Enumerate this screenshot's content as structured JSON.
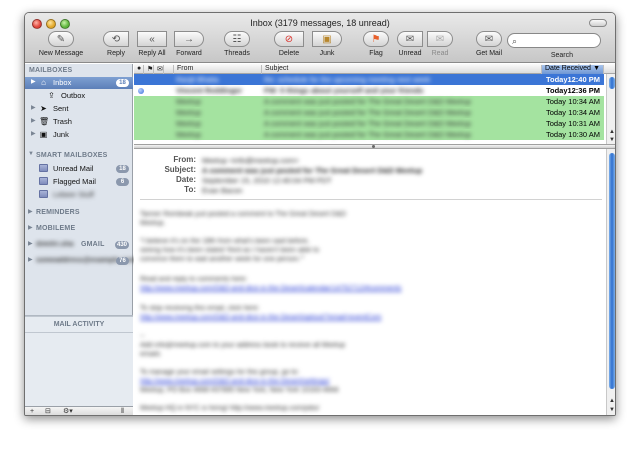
{
  "window": {
    "title": "Inbox (3179 messages, 18 unread)"
  },
  "toolbar": {
    "new_message": "New Message",
    "reply": "Reply",
    "reply_all": "Reply All",
    "forward": "Forward",
    "threads": "Threads",
    "delete": "Delete",
    "junk": "Junk",
    "flag": "Flag",
    "unread": "Unread",
    "read": "Read",
    "get_mail": "Get Mail",
    "search": "Search"
  },
  "sidebar": {
    "mailboxes_header": "MAILBOXES",
    "inbox": {
      "label": "Inbox",
      "badge": "18"
    },
    "outbox": "Outbox",
    "sent": "Sent",
    "trash": "Trash",
    "junk": "Junk",
    "smart_header": "SMART MAILBOXES",
    "unread_mail": {
      "label": "Unread Mail",
      "badge": "18"
    },
    "flagged_mail": {
      "label": "Flagged Mail",
      "badge": "6"
    },
    "smart_blurred": "Lebeer Stuff",
    "reminders_header": "REMINDERS",
    "mobileme_header": "MOBILEME",
    "gmail": {
      "prefix": "dimitri.sha",
      "label": "GMAIL",
      "badge": "430"
    },
    "account2": {
      "label": "someaddress@example.com",
      "badge": "76"
    },
    "mail_activity": "MAIL ACTIVITY"
  },
  "list": {
    "headers": {
      "from": "From",
      "subject": "Subject",
      "date": "Date Received"
    },
    "rows": [
      {
        "from": "Ranjit Bhatia",
        "subject": "Re: schedule for the upcoming meeting next week",
        "date": "Today",
        "time": "12:40 PM"
      },
      {
        "from": "Vincent Reddinger",
        "subject": "FW: 5 things about yourself and your friends",
        "date": "Today",
        "time": "12:36 PM"
      },
      {
        "from": "Meetup",
        "subject": "A comment was just posted for The Great Desert D&D Meetup",
        "date": "Today",
        "time": "10:34 AM"
      },
      {
        "from": "Meetup",
        "subject": "A comment was just posted for The Great Desert D&D Meetup",
        "date": "Today",
        "time": "10:34 AM"
      },
      {
        "from": "Meetup",
        "subject": "A comment was just posted for The Great Desert D&D Meetup",
        "date": "Today",
        "time": "10:31 AM"
      },
      {
        "from": "Meetup",
        "subject": "A comment was just posted for The Great Desert D&D Meetup",
        "date": "Today",
        "time": "10:30 AM"
      }
    ]
  },
  "preview": {
    "labels": {
      "from": "From:",
      "subject": "Subject:",
      "date": "Date:",
      "to": "To:"
    },
    "from": "Meetup <info@meetup.com>",
    "subject": "A comment was just posted for The Great Desert D&D Meetup",
    "date": "September 15, 2010 12:40:04 PM PDT",
    "to": "Evan Bacon",
    "body": [
      "Tanner Rombeak just posted a comment to The Great Desert D&D",
      "Meetup.",
      "\"I believe it's on the 18th from what's been said before,",
      "seeing how it's been stated 'third as I haven't been able to",
      "convince them to wait another week for one person.'\"",
      "Read and reply to comments here:",
      "http://www.meetup.com/D&D-and-dice-in-the-Desert/calendar/14752712/#comments",
      "To stop receiving this email, click here:",
      "http://www.meetup.com/D&D-and-dice-in-the-Desert/optout/?email=eventCom",
      "--",
      "Add info@meetup.com to your address book to receive all Meetup",
      "emails",
      "To manage your email settings for this group, go to:",
      "http://www.meetup.com/D&D-and-dice-in-the-Desert/settings/",
      "Meetup, PO Box 4668 #37895 New York, New York 10163-4668",
      "Meetup HQ in NYC is hiring! http://www.meetup.com/jobs/"
    ]
  },
  "colors": {
    "selected_row": "#3b75d6",
    "green_row": "#9fe09a",
    "sidebar_bg": "#dee4ec"
  }
}
